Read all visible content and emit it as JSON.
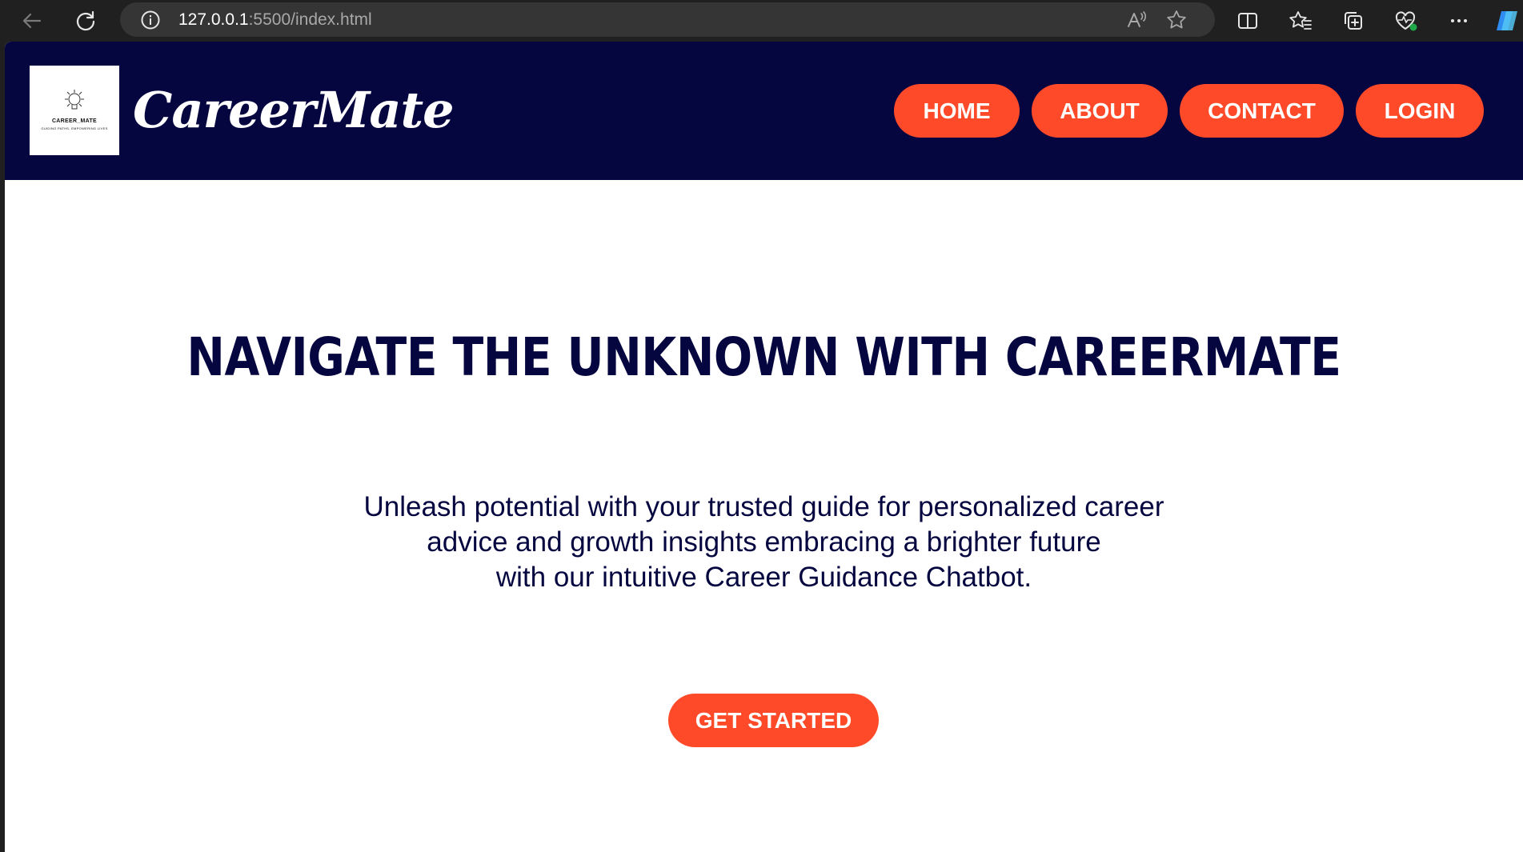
{
  "browser": {
    "url_host": "127.0.0.1",
    "url_rest": ":5500/index.html",
    "icons": [
      "back-icon",
      "refresh-icon",
      "info-icon",
      "read-aloud-icon",
      "favorite-star-icon",
      "split-screen-icon",
      "favorites-icon",
      "collections-icon",
      "browser-essentials-icon",
      "more-icon",
      "copilot-icon"
    ]
  },
  "navbar": {
    "logo_text": "CAREER_MATE",
    "logo_tagline": "GUIDING PATHS, EMPOWERING LIVES",
    "brand": "CareerMate",
    "links": [
      "HOME",
      "ABOUT",
      "CONTACT",
      "LOGIN"
    ]
  },
  "hero": {
    "title": "NAVIGATE THE UNKNOWN WITH CAREERMATE",
    "description_lines": [
      "Unleash potential with your trusted guide for personalized career",
      "advice and growth insights embracing a brighter future",
      "with our intuitive Career Guidance Chatbot."
    ],
    "cta": "GET STARTED"
  },
  "colors": {
    "navy": "#050640",
    "accent": "#ff4a29",
    "chrome": "#202020"
  }
}
